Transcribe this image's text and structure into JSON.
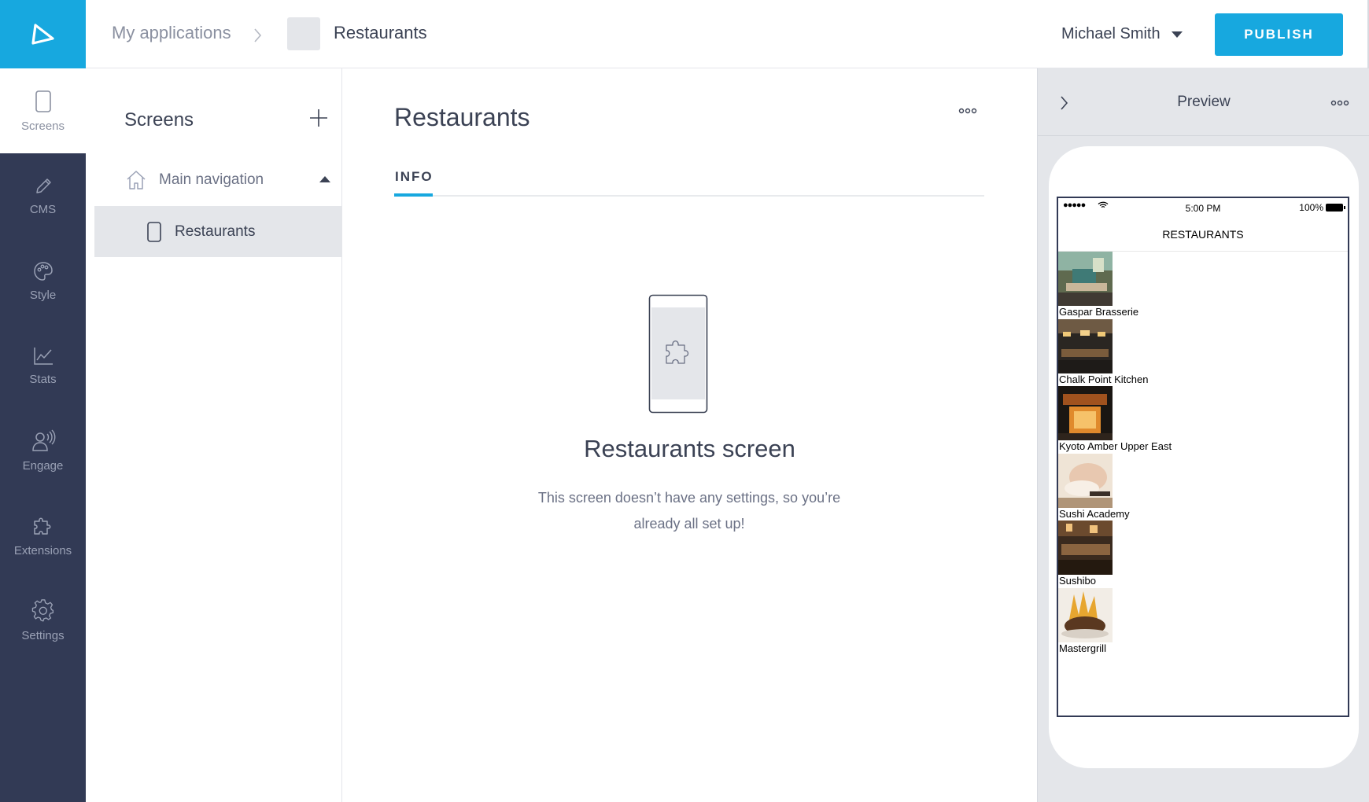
{
  "topbar": {
    "breadcrumb_root": "My applications",
    "breadcrumb_current": "Restaurants",
    "user_name": "Michael Smith",
    "publish_label": "PUBLISH"
  },
  "sidebar": {
    "items": [
      {
        "label": "Screens",
        "icon": "phone-icon",
        "active": true
      },
      {
        "label": "CMS",
        "icon": "pencil-icon"
      },
      {
        "label": "Style",
        "icon": "palette-icon"
      },
      {
        "label": "Stats",
        "icon": "chart-icon"
      },
      {
        "label": "Engage",
        "icon": "broadcast-user-icon"
      },
      {
        "label": "Extensions",
        "icon": "puzzle-icon"
      },
      {
        "label": "Settings",
        "icon": "gear-icon"
      }
    ]
  },
  "screens_panel": {
    "title": "Screens",
    "nav_group": "Main navigation",
    "screen_item": "Restaurants"
  },
  "main": {
    "title": "Restaurants",
    "tab_info": "INFO",
    "empty_title": "Restaurants screen",
    "empty_desc": "This screen doesn’t have any settings, so you’re already all set up!"
  },
  "preview": {
    "title": "Preview",
    "status_time": "5:00 PM",
    "status_battery": "100%",
    "status_signal": "●●●●●",
    "app_title": "RESTAURANTS",
    "restaurants": [
      "Gaspar Brasserie",
      "Chalk Point Kitchen",
      "Kyoto Amber Upper East",
      "Sushi Academy",
      "Sushibo",
      "Mastergrill"
    ]
  },
  "colors": {
    "accent": "#17a8df",
    "sidebar_bg": "#323a55",
    "panel_gray": "#e4e6ea",
    "text_dark": "#3b4254"
  }
}
